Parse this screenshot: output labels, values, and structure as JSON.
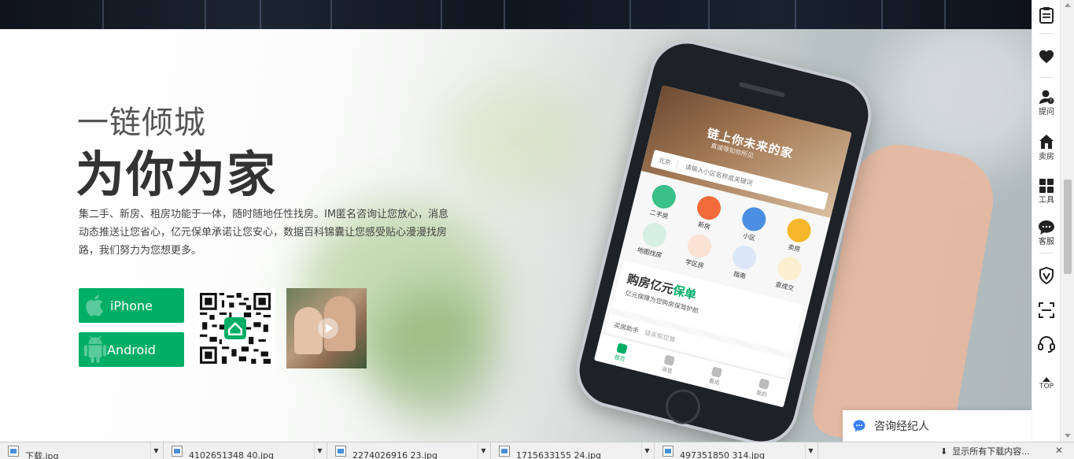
{
  "hero": {
    "title_line1": "一链倾城",
    "title_line2": "为你为家",
    "description": "集二手、新房、租房功能于一体，随时随地任性找房。IM匿名咨询让您放心，消息动态推送让您省心，亿元保单承诺让您安心，数据百科锦囊让您感受贴心漫漫找房路，我们努力为您想更多。",
    "iphone_label": "iPhone",
    "android_label": "Android"
  },
  "phone_screen": {
    "banner_title": "链上你未来的家",
    "banner_subtitle": "真诚等如你所见",
    "city": "北京",
    "search_placeholder": "请输入小区名称或关键词",
    "icons": [
      {
        "label": "二手房",
        "color": "#3cc08a"
      },
      {
        "label": "新房",
        "color": "#f26b3a"
      },
      {
        "label": "小区",
        "color": "#4a8fe3"
      },
      {
        "label": "卖房",
        "color": "#f5b62a"
      },
      {
        "label": "地图找房",
        "color": "#d6efe4"
      },
      {
        "label": "学区房",
        "color": "#fbe2d3"
      },
      {
        "label": "指南",
        "color": "#dbe7f8"
      },
      {
        "label": "查成交",
        "color": "#fcefd0"
      }
    ],
    "promo_title_a": "购房亿元",
    "promo_title_b": "保单",
    "promo_subtitle": "亿元保障为您购房保驾护航",
    "sub_title": "买房助手",
    "sub_note": "链家帮您算",
    "tabs": [
      "首页",
      "消息",
      "看房",
      "我的"
    ]
  },
  "consult": {
    "label": "咨询经纪人"
  },
  "toolbar": {
    "items": [
      {
        "icon": "clipboard-icon",
        "label": ""
      },
      {
        "icon": "heart-icon",
        "label": ""
      },
      {
        "icon": "ask-icon",
        "label": "提问"
      },
      {
        "icon": "sell-house-icon",
        "label": "卖房"
      },
      {
        "icon": "tools-icon",
        "label": "工具"
      },
      {
        "icon": "chat-icon",
        "label": "客服"
      },
      {
        "icon": "shield-icon",
        "label": ""
      },
      {
        "icon": "scan-icon",
        "label": ""
      },
      {
        "icon": "headset-icon",
        "label": ""
      },
      {
        "icon": "arrow-up-icon",
        "label": "TOP"
      }
    ]
  },
  "downloads": {
    "items": [
      {
        "name": "下载.jpg"
      },
      {
        "name": "4102651348 40.jpg"
      },
      {
        "name": "2274026916 23.jpg"
      },
      {
        "name": "1715633155 24.jpg"
      },
      {
        "name": "497351850 314.jpg"
      }
    ],
    "show_all": "显示所有下载内容..."
  },
  "colors": {
    "accent": "#00ae66"
  }
}
